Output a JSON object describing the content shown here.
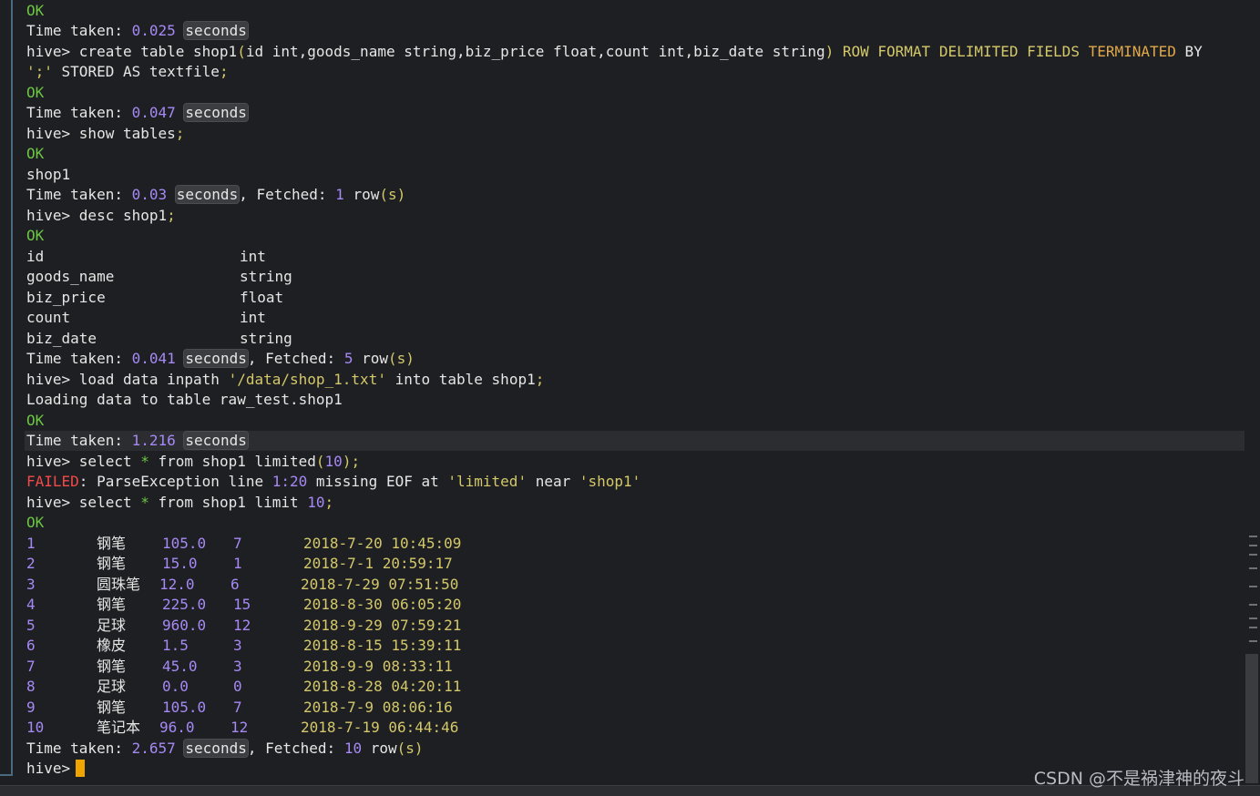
{
  "lines": {
    "l0": "OK",
    "l1_label": "Time taken: ",
    "l1_val": "0.025",
    "l1_secs": "seconds",
    "l2_a": "hive> create table shop1",
    "l2_b": "(",
    "l2_c": "id int,goods_name string,biz_price float,count int,biz_date string",
    "l2_d": ") ROW FORMAT DELIMITED FIELDS ",
    "l2_kw": "TERMINATED",
    "l2_e": " BY",
    "l3_str": "';'",
    "l3_b": " STORED AS textfile",
    "l3_semi": ";",
    "l4": "OK",
    "l5_label": "Time taken: ",
    "l5_val": "0.047",
    "l5_secs": "seconds",
    "l6_a": "hive> show tables",
    "l6_semi": ";",
    "l7": "OK",
    "l8": "shop1",
    "l9_label": "Time taken: ",
    "l9_val": "0.03",
    "l9_secs": "seconds",
    "l9_c": ", Fetched: ",
    "l9_n": "1",
    "l9_d": " row",
    "l9_e": "(s)",
    "l10_a": "hive> desc shop1",
    "l10_semi": ";",
    "l11": "OK",
    "l12_label": "Time taken: ",
    "l12_val": "0.041",
    "l12_secs": "seconds",
    "l12_c": ", Fetched: ",
    "l12_n": "5",
    "l12_d": " row",
    "l12_e": "(s)",
    "l13_a": "hive> load data inpath ",
    "l13_str": "'/data/shop_1.txt'",
    "l13_b": " into table shop1",
    "l13_semi": ";",
    "l14": "Loading data to table raw_test.shop1",
    "l15": "OK",
    "l16_label": "Time taken: ",
    "l16_val": "1.216",
    "l16_secs": "seconds",
    "l17_a": "hive> select ",
    "l17_star": "*",
    "l17_b": " from shop1 limited",
    "l17_p1": "(",
    "l17_n": "10",
    "l17_p2": ");",
    "l18_fail": "FAILED",
    "l18_b": ": ParseException line ",
    "l18_n": "1:20",
    "l18_c": " missing EOF at ",
    "l18_s1": "'limited'",
    "l18_d": " near ",
    "l18_s2": "'shop1'",
    "l19_a": "hive> select ",
    "l19_star": "*",
    "l19_b": " from shop1 limit ",
    "l19_n": "10",
    "l19_semi": ";",
    "l20": "OK",
    "l31_label": "Time taken: ",
    "l31_val": "2.657",
    "l31_secs": "seconds",
    "l31_c": ", Fetched: ",
    "l31_n": "10",
    "l31_d": " row",
    "l31_e": "(s)",
    "l32": "hive>"
  },
  "schema": [
    {
      "col": "id",
      "type": "int"
    },
    {
      "col": "goods_name",
      "type": "string"
    },
    {
      "col": "biz_price",
      "type": "float"
    },
    {
      "col": "count",
      "type": "int"
    },
    {
      "col": "biz_date",
      "type": "string"
    }
  ],
  "rows": [
    {
      "id": "1",
      "name": "钢笔",
      "price": "105.0",
      "count": "7",
      "date": "2018-7-20 10:45:09"
    },
    {
      "id": "2",
      "name": "钢笔",
      "price": "15.0",
      "count": "1",
      "date": "2018-7-1 20:59:17"
    },
    {
      "id": "3",
      "name": "圆珠笔",
      "price": "12.0",
      "count": "6",
      "date": "2018-7-29 07:51:50"
    },
    {
      "id": "4",
      "name": "钢笔",
      "price": "225.0",
      "count": "15",
      "date": "2018-8-30 06:05:20"
    },
    {
      "id": "5",
      "name": "足球",
      "price": "960.0",
      "count": "12",
      "date": "2018-9-29 07:59:21"
    },
    {
      "id": "6",
      "name": "橡皮",
      "price": "1.5",
      "count": "3",
      "date": "2018-8-15 15:39:11"
    },
    {
      "id": "7",
      "name": "钢笔",
      "price": "45.0",
      "count": "3",
      "date": "2018-9-9 08:33:11"
    },
    {
      "id": "8",
      "name": "足球",
      "price": "0.0",
      "count": "0",
      "date": "2018-8-28 04:20:11"
    },
    {
      "id": "9",
      "name": "钢笔",
      "price": "105.0",
      "count": "7",
      "date": "2018-7-9 08:06:16"
    },
    {
      "id": "10",
      "name": "笔记本",
      "price": "96.0",
      "count": "12",
      "date": "2018-7-19 06:44:46"
    }
  ],
  "watermark": "CSDN @不是祸津神的夜斗",
  "colors": {
    "background": "#1e1f22",
    "ok": "#6cc644",
    "number": "#a689f5",
    "string": "#d4c86a",
    "keyword": "#e0a84a",
    "failed": "#f04a4a",
    "cursor": "#f0a400"
  }
}
